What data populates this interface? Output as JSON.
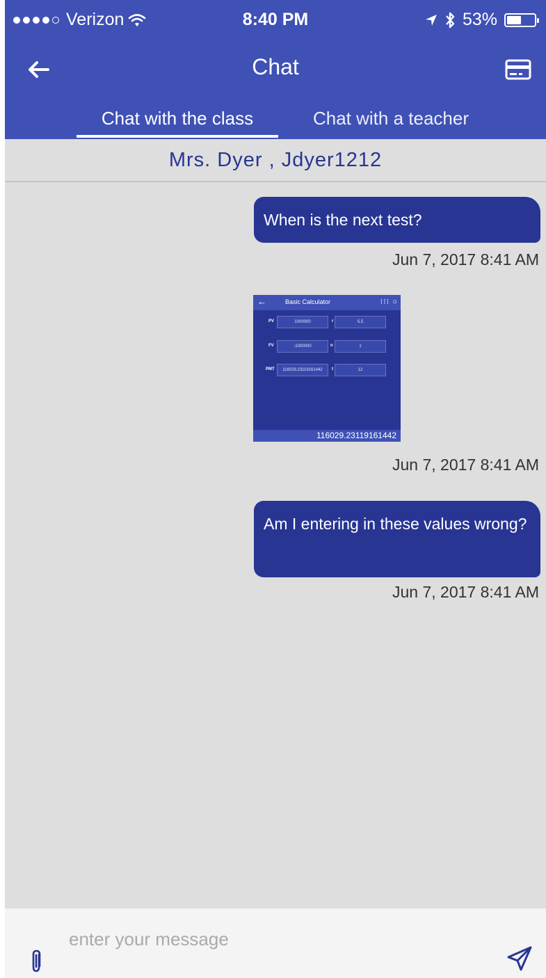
{
  "status_bar": {
    "carrier": "Verizon",
    "time": "8:40 PM",
    "battery_text": "53%",
    "battery_level": 0.53,
    "signal_bars": 4
  },
  "header": {
    "title": "Chat",
    "back_icon": "arrow-left-icon",
    "right_icon": "credit-card-icon"
  },
  "tabs": [
    {
      "label": "Chat with the class",
      "active": true
    },
    {
      "label": "Chat with a teacher",
      "active": false
    }
  ],
  "contact": {
    "name": "Mrs. Dyer , Jdyer1212"
  },
  "messages": [
    {
      "type": "text",
      "text": "When is the next test?",
      "timestamp": "Jun 7, 2017 8:41 AM"
    },
    {
      "type": "image",
      "timestamp": "Jun 7, 2017 8:41 AM",
      "image": {
        "title": "Basic Calculator",
        "fields": [
          {
            "label": "PV",
            "value": "1000000"
          },
          {
            "label": "r",
            "value": "5.5"
          },
          {
            "label": "FV",
            "value": "-1000000"
          },
          {
            "label": "n",
            "value": "1"
          },
          {
            "label": "PMT",
            "value": "116029.23119161442"
          },
          {
            "label": "t",
            "value": "12"
          }
        ],
        "result": "116029.23119161442"
      }
    },
    {
      "type": "text",
      "text": "Am I entering in these values wrong?",
      "timestamp": "Jun 7, 2017 8:41 AM"
    }
  ],
  "composer": {
    "placeholder": "enter your message",
    "value": "",
    "attach_icon": "paperclip-icon",
    "send_icon": "send-icon"
  },
  "colors": {
    "primary": "#3f51b5",
    "bubble": "#283593",
    "chat_bg": "#dedede",
    "composer_bg": "#f4f4f4"
  }
}
